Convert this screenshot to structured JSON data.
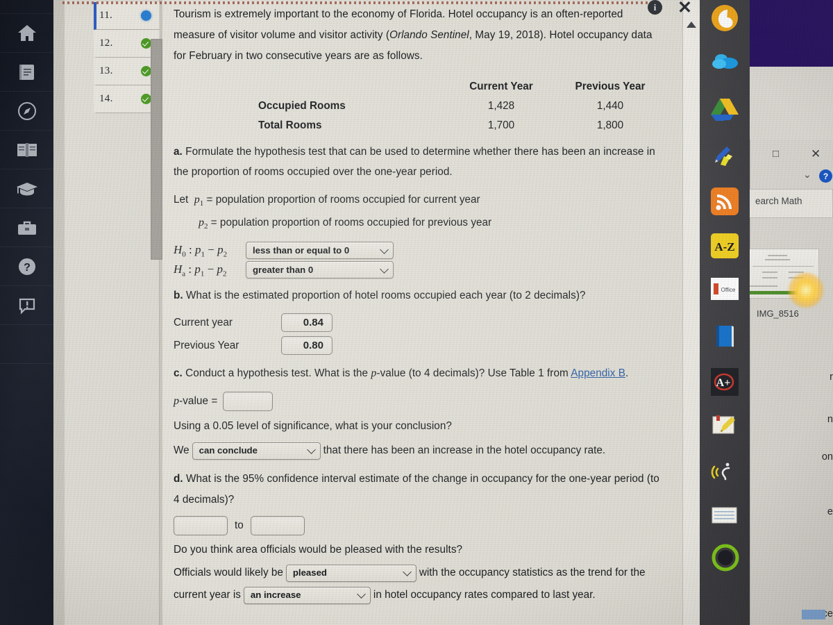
{
  "question_list": {
    "items": [
      {
        "number": "11.",
        "status": "current"
      },
      {
        "number": "12.",
        "status": "complete"
      },
      {
        "number": "13.",
        "status": "complete"
      },
      {
        "number": "14.",
        "status": "complete"
      }
    ]
  },
  "problem": {
    "intro_1": "Tourism is extremely important to the economy of Florida. Hotel occupancy is an often-reported measure of visitor volume and visitor activity (",
    "source_italic": "Orlando Sentinel",
    "intro_2": ", May 19, 2018). Hotel occupancy data for February in two consecutive years are as follows.",
    "table": {
      "columns": [
        "Current Year",
        "Previous Year"
      ],
      "rows": [
        {
          "label": "Occupied Rooms",
          "current": "1,428",
          "previous": "1,440"
        },
        {
          "label": "Total Rooms",
          "current": "1,700",
          "previous": "1,800"
        }
      ]
    },
    "part_a": {
      "letter": "a.",
      "text": "Formulate the hypothesis test that can be used to determine whether there has been an increase in the proportion of rooms occupied over the one-year period.",
      "let_line_1_prefix": "Let",
      "let_line_1": "= population proportion of rooms occupied for current year",
      "let_line_2": "= population proportion of rooms occupied for previous year",
      "h0_label": "H",
      "h0_sub": "0",
      "ha_sub": "a",
      "h0_value": "less than or equal to 0",
      "ha_value": "greater than 0"
    },
    "part_b": {
      "letter": "b.",
      "text": "What is the estimated proportion of hotel rooms occupied each year (to 2 decimals)?",
      "rows": [
        {
          "label": "Current year",
          "value": "0.84"
        },
        {
          "label": "Previous Year",
          "value": "0.80"
        }
      ]
    },
    "part_c": {
      "letter": "c.",
      "text_1": "Conduct a hypothesis test. What is the ",
      "text_p": "p",
      "text_2": "-value (to 4 decimals)? Use Table 1 from ",
      "link": "Appendix B",
      "text_3": ".",
      "pvalue_label_p": "p",
      "pvalue_label_rest": "-value =",
      "pvalue_input": "",
      "significance_text": "Using a 0.05 level of significance, what is your conclusion?",
      "conclusion_prefix": "We",
      "conclusion_value": "can conclude",
      "conclusion_suffix": "that there has been an increase in the hotel occupancy rate."
    },
    "part_d": {
      "letter": "d.",
      "text": "What is the 95% confidence interval estimate of the change in occupancy for the one-year period (to 4 decimals)?",
      "ci_lower": "",
      "ci_upper": "",
      "ci_joiner": "to",
      "question": "Do you think area officials would be pleased with the results?",
      "officials_prefix": "Officials would likely be",
      "officials_value": "pleased",
      "officials_middle": "with the occupancy statistics as the trend for the current year is",
      "trend_value": "an increase",
      "officials_suffix": "in hotel occupancy rates compared to last year."
    }
  },
  "left_rail": {
    "items": [
      {
        "icon": "home-icon"
      },
      {
        "icon": "notebook-icon"
      },
      {
        "icon": "compass-icon"
      },
      {
        "icon": "open-book-icon"
      },
      {
        "icon": "graduation-cap-icon"
      },
      {
        "icon": "briefcase-icon"
      },
      {
        "icon": "question-mark-icon"
      },
      {
        "icon": "alert-message-icon"
      }
    ]
  },
  "right_toolbar": {
    "items": [
      {
        "icon": "bitdefender-icon"
      },
      {
        "icon": "onedrive-cloud-icon"
      },
      {
        "icon": "google-drive-icon"
      },
      {
        "icon": "pen-highlighter-icon"
      },
      {
        "icon": "rss-feed-icon"
      },
      {
        "icon": "a-z-dictionary-icon",
        "label": "A-Z"
      },
      {
        "icon": "ms-office-icon",
        "label": "Office"
      },
      {
        "icon": "blue-book-icon"
      },
      {
        "icon": "a-plus-grade-icon",
        "label": "A+"
      },
      {
        "icon": "notepad-pencil-icon"
      },
      {
        "icon": "text-to-speech-icon"
      },
      {
        "icon": "lined-paper-icon"
      },
      {
        "icon": "green-ring-avatar-icon"
      }
    ]
  },
  "background_window": {
    "search_placeholder": "earch Math",
    "thumbnail_label": "IMG_8516",
    "help_label": "?",
    "maximize_label": "□",
    "close_label": "✕",
    "chevron_label": "⌄",
    "cut_text": [
      "r",
      "n",
      "on",
      "e",
      "ce"
    ]
  },
  "overlay": {
    "info_label": "i",
    "close_label": "✕"
  }
}
